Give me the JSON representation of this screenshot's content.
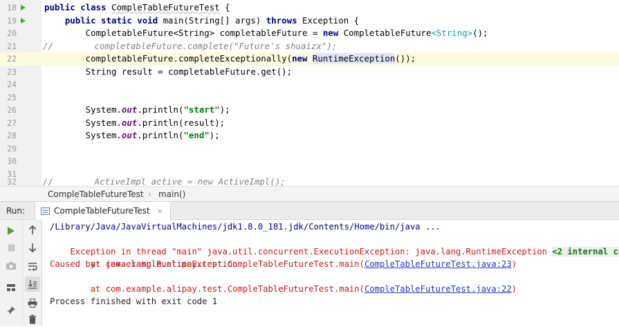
{
  "editor": {
    "lines": [
      {
        "num": "18",
        "run": true
      },
      {
        "num": "19",
        "run": true
      },
      {
        "num": "20",
        "run": false
      },
      {
        "num": "21",
        "run": false
      },
      {
        "num": "22",
        "run": false
      },
      {
        "num": "23",
        "run": false
      },
      {
        "num": "24",
        "run": false
      },
      {
        "num": "25",
        "run": false
      },
      {
        "num": "26",
        "run": false
      },
      {
        "num": "27",
        "run": false
      },
      {
        "num": "28",
        "run": false
      },
      {
        "num": "29",
        "run": false
      },
      {
        "num": "30",
        "run": false
      },
      {
        "num": "31",
        "run": false
      },
      {
        "num": "32",
        "run": false
      }
    ],
    "code": {
      "l18_kw": "public class ",
      "l18_name": "CompleTableFutureTest",
      "l18_rest": " {",
      "l19_indent": "    ",
      "l19_kw1": "public static void ",
      "l19_mid": "main(String[] args) ",
      "l19_kw2": "throws ",
      "l19_rest": "Exception {",
      "l20_a": "        CompletableFuture<String> completableFuture = ",
      "l20_kw": "new ",
      "l20_b": "CompletableFuture",
      "l20_gen": "<String>",
      "l20_c": "();",
      "l21_slash": "//",
      "l21_comment": "        completableFuture.complete(\"Future's shuaizx\");",
      "l22_a": "        completableFuture.completeExceptionally(",
      "l22_kw": "new ",
      "l22_hl": "RuntimeException",
      "l22_b": "());",
      "l23": "        String result = completableFuture.get();",
      "l26_a": "        System.",
      "l26_fld": "out",
      "l26_b": ".println(",
      "l26_str": "\"start\"",
      "l26_c": ");",
      "l27_a": "        System.",
      "l27_fld": "out",
      "l27_b": ".println(result);",
      "l28_a": "        System.",
      "l28_fld": "out",
      "l28_b": ".println(",
      "l28_str": "\"end\"",
      "l28_c": ");",
      "l32_slash": "//",
      "l32_comment": "        ActiveImpl active = new ActiveImpl();"
    }
  },
  "breadcrumb": {
    "class_name": "CompleTableFutureTest",
    "separator": "›",
    "method": "main()"
  },
  "run_panel": {
    "label": "Run:",
    "tab_title": "CompleTableFutureTest",
    "tab_close": "×"
  },
  "console": {
    "java_path": "/Library/Java/JavaVirtualMachines/jdk1.8.0_181.jdk/Contents/Home/bin/java ...",
    "exception_line": "Exception in thread \"main\" java.util.concurrent.ExecutionException: java.lang.RuntimeException ",
    "internal_calls": "<2 internal calls>",
    "at1_prefix": "    at com.example.alipay.test.CompleTableFutureTest.main(",
    "at1_link": "CompleTableFutureTest.java:23",
    "at1_suffix": ")",
    "caused_by": "Caused by: java.lang.RuntimeException",
    "at2_prefix": "    at com.example.alipay.test.CompleTableFutureTest.main(",
    "at2_link": "CompleTableFutureTest.java:22",
    "at2_suffix": ")",
    "exit_message": "Process finished with exit code 1"
  },
  "icons": {
    "rerun": "run-icon",
    "stop": "stop-icon",
    "camera": "camera-icon",
    "layout": "layout-icon",
    "pin": "pin-icon",
    "up": "up-arrow-icon",
    "down": "down-arrow-icon",
    "wrap": "soft-wrap-icon",
    "scroll_end": "scroll-to-end-icon",
    "print": "print-icon",
    "trash": "trash-icon"
  },
  "colors": {
    "keyword": "#000080",
    "string": "#008000",
    "comment": "#808080",
    "error": "#c41a16",
    "link": "#1f33c4",
    "run_green": "#4c9f40",
    "current_line": "#fcfbe0"
  }
}
